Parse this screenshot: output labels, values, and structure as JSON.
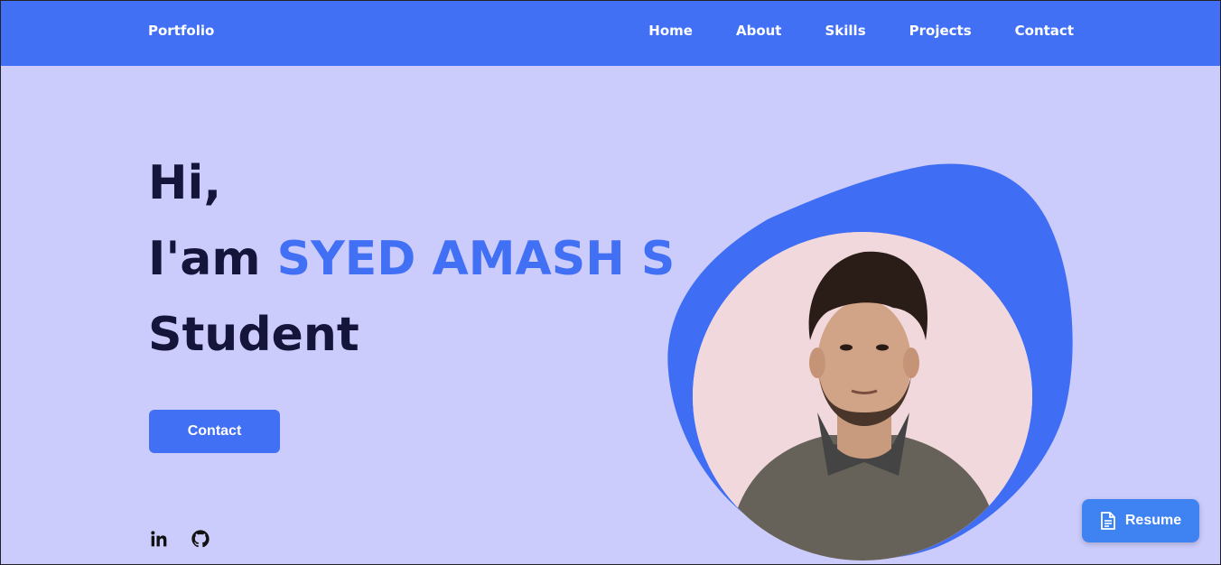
{
  "header": {
    "brand": "Portfolio",
    "nav": [
      {
        "label": "Home"
      },
      {
        "label": "About"
      },
      {
        "label": "Skills"
      },
      {
        "label": "Projects"
      },
      {
        "label": "Contact"
      }
    ]
  },
  "hero": {
    "greeting": "Hi,",
    "intro_prefix": "I'am",
    "name": "SYED AMASH S",
    "role": "Student",
    "contact_label": "Contact"
  },
  "socials": [
    {
      "icon": "linkedin-icon"
    },
    {
      "icon": "github-icon"
    }
  ],
  "resume": {
    "label": "Resume",
    "icon": "document-icon"
  },
  "colors": {
    "accent": "#4170f5",
    "background": "#cbcbfc",
    "text": "#15143a",
    "resume": "#3f82f2"
  }
}
